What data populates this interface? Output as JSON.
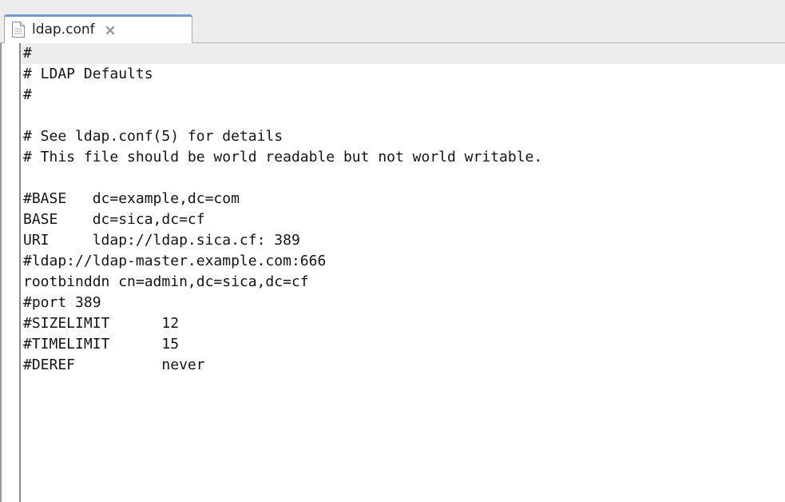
{
  "tab": {
    "label": "ldap.conf",
    "icon": "document-icon",
    "close_icon": "close-icon"
  },
  "editor": {
    "lines": [
      "#",
      "# LDAP Defaults",
      "#",
      "",
      "# See ldap.conf(5) for details",
      "# This file should be world readable but not world writable.",
      "",
      "#BASE   dc=example,dc=com",
      "BASE    dc=sica,dc=cf",
      "URI     ldap://ldap.sica.cf: 389",
      "#ldap://ldap-master.example.com:666",
      "rootbinddn cn=admin,dc=sica,dc=cf",
      "#port 389",
      "#SIZELIMIT      12",
      "#TIMELIMIT      15",
      "#DEREF          never"
    ]
  },
  "colors": {
    "current_line": "#ededed",
    "tab_accent": "#6f9ed6",
    "text": "#141414"
  }
}
